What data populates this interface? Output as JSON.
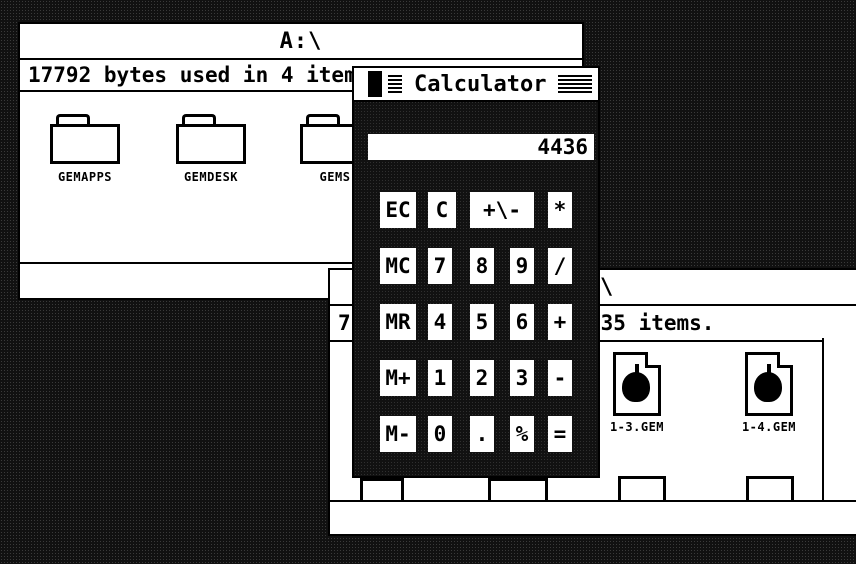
{
  "window_a": {
    "title": "A:\\",
    "info": "17792 bytes used in 4 items.",
    "icons": [
      "GEMAPPS",
      "GEMDESK",
      "GEMS"
    ]
  },
  "window_b": {
    "info_partial_left": "7",
    "info_partial_right": "35 items.",
    "partial_title_char": "\\",
    "files": [
      "1-3.GEM",
      "1-4.GEM"
    ]
  },
  "calculator": {
    "title": "Calculator",
    "display": "4436",
    "keys": {
      "ec": "EC",
      "c": "C",
      "plusminus": "+\\-",
      "mul": "*",
      "mc": "MC",
      "k7": "7",
      "k8": "8",
      "k9": "9",
      "div": "/",
      "mr": "MR",
      "k4": "4",
      "k5": "5",
      "k6": "6",
      "add": "+",
      "mplus": "M+",
      "k1": "1",
      "k2": "2",
      "k3": "3",
      "sub": "-",
      "mminus": "M-",
      "k0": "0",
      "dot": ".",
      "pct": "%",
      "eq": "="
    }
  },
  "colors": {
    "desktop": "#111111",
    "window": "#ffffff",
    "ink": "#000000"
  },
  "icon_names": [
    "folder-icon",
    "document-icon",
    "bomb-icon"
  ]
}
